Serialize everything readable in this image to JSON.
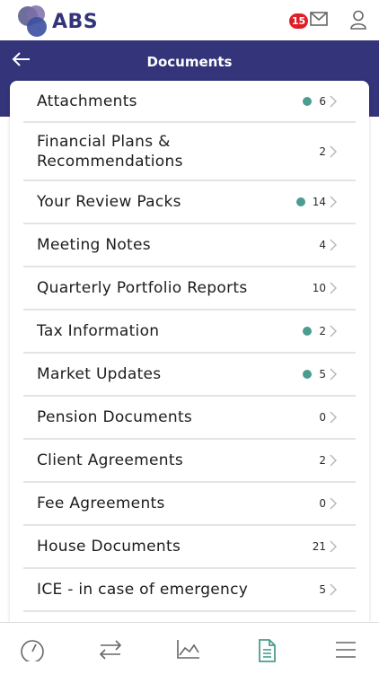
{
  "app": {
    "logo_text": "ABS",
    "notification_count": "15"
  },
  "header": {
    "title": "Documents"
  },
  "documents": [
    {
      "label": "Attachments",
      "count": "6",
      "new": true
    },
    {
      "label": "Financial Plans &\nRecommendations",
      "count": "2",
      "new": false
    },
    {
      "label": "Your Review Packs",
      "count": "14",
      "new": true
    },
    {
      "label": "Meeting Notes",
      "count": "4",
      "new": false
    },
    {
      "label": "Quarterly Portfolio Reports",
      "count": "10",
      "new": false
    },
    {
      "label": "Tax Information",
      "count": "2",
      "new": true
    },
    {
      "label": "Market Updates",
      "count": "5",
      "new": true
    },
    {
      "label": "Pension Documents",
      "count": "0",
      "new": false
    },
    {
      "label": "Client Agreements",
      "count": "2",
      "new": false
    },
    {
      "label": "Fee Agreements",
      "count": "0",
      "new": false
    },
    {
      "label": "House Documents",
      "count": "21",
      "new": false
    },
    {
      "label": "ICE - in case of emergency",
      "count": "5",
      "new": false
    }
  ],
  "colors": {
    "primary": "#33347a",
    "new_dot": "#4a9d8f",
    "badge": "#e01e26",
    "active_nav": "#4a9d8f"
  },
  "bottom_nav": [
    {
      "icon": "dashboard-gauge-icon",
      "active": false
    },
    {
      "icon": "transfer-arrows-icon",
      "active": false
    },
    {
      "icon": "performance-chart-icon",
      "active": false
    },
    {
      "icon": "documents-icon",
      "active": true
    },
    {
      "icon": "menu-icon",
      "active": false
    }
  ]
}
